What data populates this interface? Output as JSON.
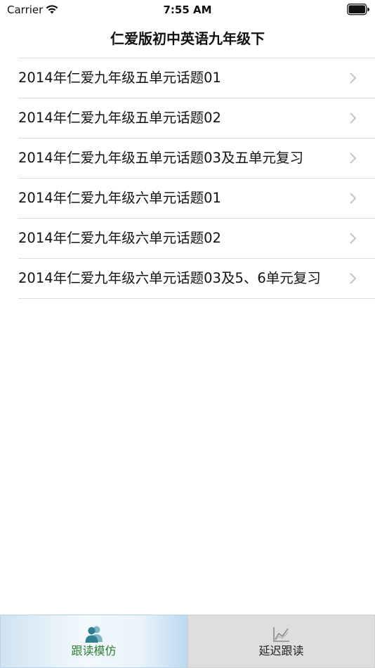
{
  "status_bar": {
    "carrier": "Carrier",
    "time": "7:55 AM",
    "wifi_icon": "wifi-icon",
    "battery_icon": "battery-icon"
  },
  "nav": {
    "title": "仁爱版初中英语九年级下"
  },
  "list": {
    "items": [
      {
        "label": "2014年仁爱九年级五单元话题01"
      },
      {
        "label": "2014年仁爱九年级五单元话题02"
      },
      {
        "label": "2014年仁爱九年级五单元话题03及五单元复习"
      },
      {
        "label": "2014年仁爱九年级六单元话题01"
      },
      {
        "label": "2014年仁爱九年级六单元话题02"
      },
      {
        "label": "2014年仁爱九年级六单元话题03及5、6单元复习"
      }
    ],
    "chevron_icon": "chevron-right-icon"
  },
  "tab_bar": {
    "tabs": [
      {
        "label": "跟读模仿",
        "icon": "users-icon",
        "selected": true
      },
      {
        "label": "延迟跟读",
        "icon": "chart-icon",
        "selected": false
      }
    ]
  },
  "colors": {
    "accent": "#2e7d32",
    "tab_icon_active": "#2f7f91",
    "separator": "#dcdcdc",
    "chevron": "#c4c4c7"
  }
}
